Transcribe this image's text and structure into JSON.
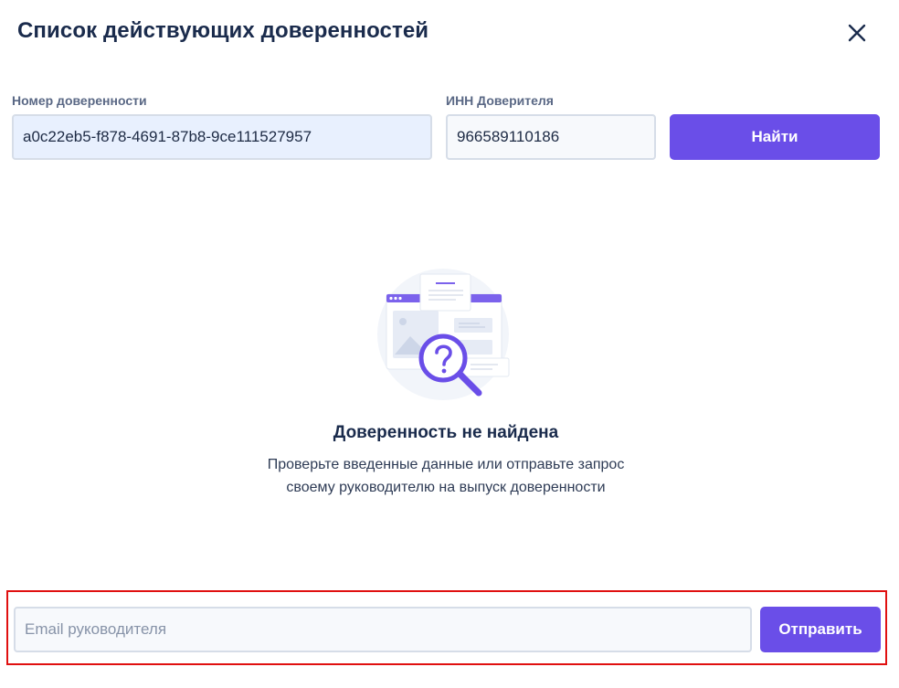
{
  "dialog": {
    "title": "Список действующих доверенностей",
    "close_icon": "close-icon"
  },
  "search": {
    "number_label": "Номер доверенности",
    "number_value": "a0c22eb5-f878-4691-87b8-9ce111527957",
    "inn_label": "ИНН Доверителя",
    "inn_value": "966589110186",
    "find_button": "Найти"
  },
  "empty_state": {
    "illustration_icon": "document-search-icon",
    "title": "Доверенность не найдена",
    "description_line1": "Проверьте введенные данные или отправьте запрос",
    "description_line2": "своему руководителю на выпуск доверенности"
  },
  "request": {
    "email_placeholder": "Email руководителя",
    "email_value": "",
    "send_button": "Отправить"
  },
  "colors": {
    "accent": "#6a4ee8",
    "highlight_border": "#e01010",
    "title_text": "#1a2b4c"
  }
}
